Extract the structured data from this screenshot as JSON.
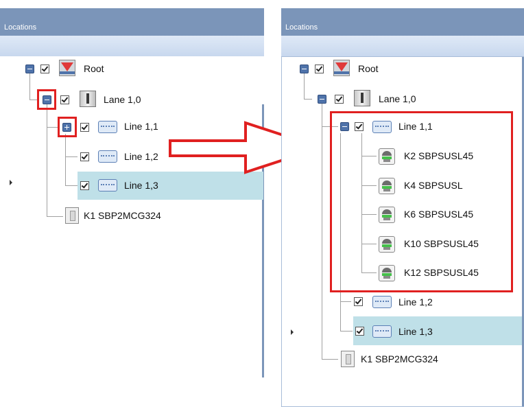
{
  "left_panel": {
    "title": "Locations",
    "tree": {
      "root": "Root",
      "lane": "Lane 1,0",
      "line1": "Line 1,1",
      "line2": "Line 1,2",
      "line3": "Line 1,3",
      "controller": "K1 SBP2MCG324"
    }
  },
  "right_panel": {
    "title": "Locations",
    "tree": {
      "root": "Root",
      "lane": "Lane 1,0",
      "line1": "Line 1,1",
      "sensors": [
        "K2 SBPSUSL45",
        "K4 SBPSUSL",
        "K6 SBPSUSL45",
        "K10 SBPSUSL45",
        "K12 SBPSUSL45"
      ],
      "line2": "Line 1,2",
      "line3": "Line 1,3",
      "controller": "K1 SBP2MCG324"
    }
  },
  "colors": {
    "title_bar": "#7b95b9",
    "selected_row": "#bfe0e8",
    "highlight": "#e02020"
  },
  "icons": [
    "root-icon",
    "lane-icon",
    "line-icon",
    "sensor-icon",
    "controller-icon",
    "expand-icon",
    "collapse-icon",
    "checkbox-icon",
    "arrow-icon"
  ]
}
